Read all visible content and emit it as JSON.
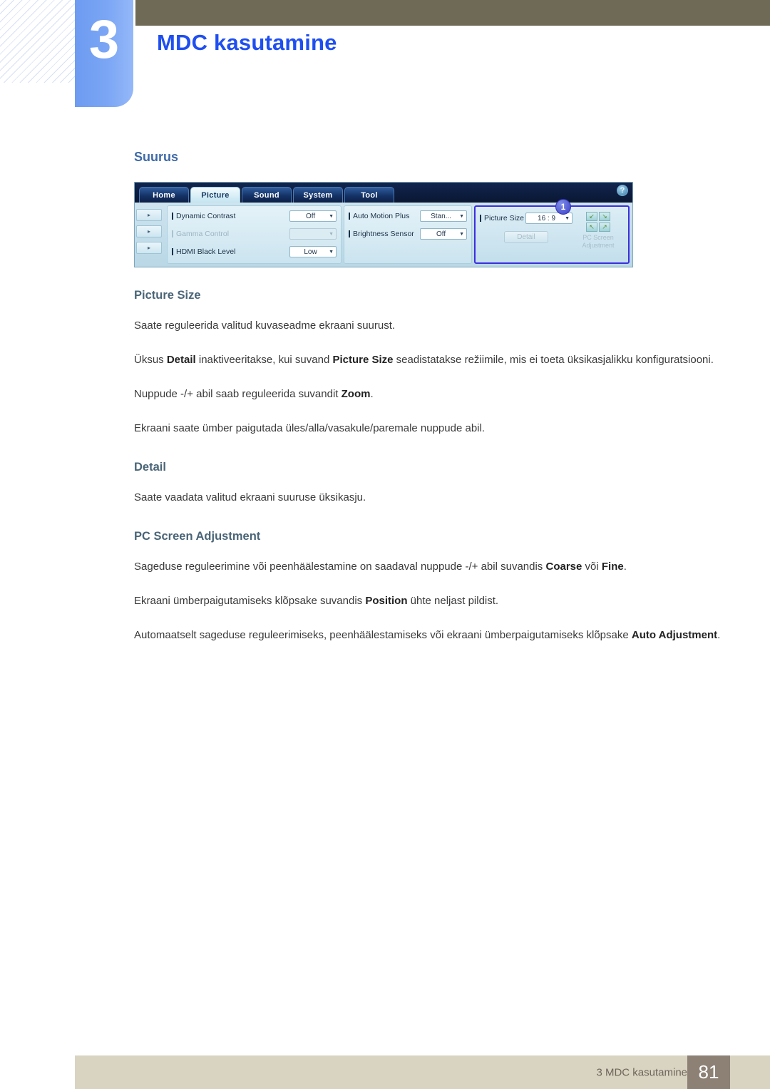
{
  "header": {
    "chapter_number": "3",
    "chapter_title": "MDC kasutamine"
  },
  "content": {
    "section_heading": "Suurus"
  },
  "mdc_screenshot": {
    "help_icon_label": "?",
    "tabs": [
      {
        "label": "Home",
        "active": false
      },
      {
        "label": "Picture",
        "active": true
      },
      {
        "label": "Sound",
        "active": false
      },
      {
        "label": "System",
        "active": false
      },
      {
        "label": "Tool",
        "active": false
      }
    ],
    "arrow_buttons": [
      "▸",
      "▸",
      "▸"
    ],
    "group_left": [
      {
        "label": "Dynamic Contrast",
        "value": "Off",
        "disabled": false
      },
      {
        "label": "Gamma Control",
        "value": "",
        "disabled": true
      },
      {
        "label": "HDMI Black Level",
        "value": "Low",
        "disabled": false
      }
    ],
    "group_middle": [
      {
        "label": "Auto Motion Plus",
        "value": "Stan...",
        "disabled": false
      },
      {
        "label": "Brightness Sensor",
        "value": "Off",
        "disabled": false
      }
    ],
    "group_right": {
      "callout_number": "1",
      "picture_size_label": "Picture Size",
      "picture_size_value": "16 : 9",
      "detail_button_label": "Detail",
      "pc_screen_label_line1": "PC Screen",
      "pc_screen_label_line2": "Adjustment",
      "pc_arrows": [
        "↙",
        "↘",
        "↖",
        "↗"
      ]
    },
    "highlight_color": "#3b2fe0"
  },
  "sections": [
    {
      "heading": "Picture Size",
      "paragraphs": [
        [
          {
            "t": "Saate reguleerida valitud kuvaseadme ekraani suurust.",
            "b": false
          }
        ],
        [
          {
            "t": "Üksus ",
            "b": false
          },
          {
            "t": "Detail",
            "b": true
          },
          {
            "t": " inaktiveeritakse, kui suvand ",
            "b": false
          },
          {
            "t": "Picture Size",
            "b": true
          },
          {
            "t": " seadistatakse režiimile, mis ei toeta üksikasjalikku konfiguratsiooni.",
            "b": false
          }
        ],
        [
          {
            "t": "Nuppude -/+ abil saab reguleerida suvandit ",
            "b": false
          },
          {
            "t": "Zoom",
            "b": true
          },
          {
            "t": ".",
            "b": false
          }
        ],
        [
          {
            "t": "Ekraani saate ümber paigutada üles/alla/vasakule/paremale nuppude abil.",
            "b": false
          }
        ]
      ]
    },
    {
      "heading": "Detail",
      "paragraphs": [
        [
          {
            "t": "Saate vaadata valitud ekraani suuruse üksikasju.",
            "b": false
          }
        ]
      ]
    },
    {
      "heading": "PC Screen Adjustment",
      "paragraphs": [
        [
          {
            "t": "Sageduse reguleerimine või peenhäälestamine on saadaval nuppude -/+ abil suvandis ",
            "b": false
          },
          {
            "t": "Coarse",
            "b": true
          },
          {
            "t": " või ",
            "b": false
          },
          {
            "t": "Fine",
            "b": true
          },
          {
            "t": ".",
            "b": false
          }
        ],
        [
          {
            "t": "Ekraani ümberpaigutamiseks klõpsake suvandis ",
            "b": false
          },
          {
            "t": "Position",
            "b": true
          },
          {
            "t": " ühte neljast pildist.",
            "b": false
          }
        ],
        [
          {
            "t": "Automaatselt sageduse reguleerimiseks, peenhäälestamiseks või ekraani ümberpaigutamiseks klõpsake ",
            "b": false
          },
          {
            "t": "Auto Adjustment",
            "b": true
          },
          {
            "t": ".",
            "b": false
          }
        ]
      ]
    }
  ],
  "footer": {
    "text": "3 MDC kasutamine",
    "page_number": "81"
  }
}
